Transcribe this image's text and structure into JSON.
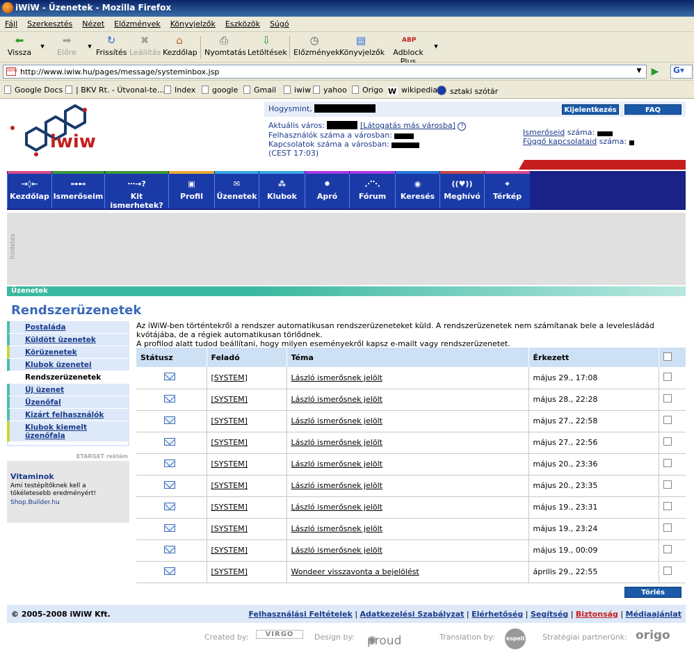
{
  "window": {
    "title": "iWiW - Üzenetek - Mozilla Firefox"
  },
  "menu": [
    "Fájl",
    "Szerkesztés",
    "Nézet",
    "Előzmények",
    "Könyvjelzők",
    "Eszközök",
    "Súgó"
  ],
  "toolbar": {
    "back": "Vissza",
    "forward": "Előre",
    "reload": "Frissítés",
    "stop": "Leállítás",
    "home": "Kezdőlap",
    "print": "Nyomtatás",
    "downloads": "Letöltések",
    "history": "Előzmények",
    "bookmarks": "Könyvjelzők",
    "adblock": "Adblock Plus"
  },
  "url": "http://www.iwiw.hu/pages/message/systeminbox.jsp",
  "bookmarks": [
    "Google Docs",
    "| BKV Rt. - Útvonal-te...",
    "Index",
    "google",
    "Gmail",
    "iwiw",
    "yahoo",
    "Origo",
    "wikipedia",
    "sztaki szótár"
  ],
  "header": {
    "greeting": "Hogysmint,",
    "logout": "Kijelentkezés",
    "faq": "FAQ",
    "city_label": "Aktuális város:",
    "visit_other": "[Látogatás más városba]",
    "users_label": "Felhasználók száma a városban:",
    "connections_label": "Kapcsolatok száma a városban:",
    "time": "(CEST 17:03)",
    "friends_link": "Ismerőseid",
    "friends_suffix": " száma:",
    "pending_link": "Függő kapcsolataid",
    "pending_suffix": " száma:"
  },
  "nav": [
    {
      "label": "Kezdőlap",
      "icon": "→◊←",
      "color": "#d84a8a"
    },
    {
      "label": "Ismerőseim",
      "icon": "⊶⊷",
      "color": "#3a9a3a"
    },
    {
      "label": "Kit ismerhetek?",
      "icon": "⋯→?",
      "color": "#3a9a3a"
    },
    {
      "label": "Profil",
      "icon": "▣",
      "color": "#e8a838"
    },
    {
      "label": "Üzenetek",
      "icon": "✉",
      "color": "#38a8e8"
    },
    {
      "label": "Klubok",
      "icon": "⁂",
      "color": "#38a8e8"
    },
    {
      "label": "Apró",
      "icon": "✸",
      "color": "#a838e8"
    },
    {
      "label": "Fórum",
      "icon": "⋰⋱",
      "color": "#a838e8"
    },
    {
      "label": "Keresés",
      "icon": "◉",
      "color": "#2878d8"
    },
    {
      "label": "Meghívó",
      "icon": "((♥))",
      "color": "#c84848"
    },
    {
      "label": "Térkép",
      "icon": "⌖",
      "color": "#d84a8a"
    }
  ],
  "ad_label": "hirdetés",
  "breadcrumb": "Üzenetek",
  "page_title": "Rendszerüzenetek",
  "sidebar": [
    {
      "label": "Postaláda"
    },
    {
      "label": "Küldött üzenetek"
    },
    {
      "label": "Körüzenetek"
    },
    {
      "label": "Klubok üzenetei"
    },
    {
      "label": "Rendszerüzenetek"
    },
    {
      "label": "Új üzenet"
    },
    {
      "label": "Üzenőfal"
    },
    {
      "label": "Kizárt felhasználók"
    },
    {
      "label": "Klubok kiemelt üzenőfala"
    }
  ],
  "promo": {
    "header": "ETARGET reklám",
    "title": "Vitaminok",
    "text": "Ami testépítőknek kell a tökéletesebb eredményért!",
    "link": "Shop.Builder.hu"
  },
  "intro": "Az iWiW-ben történtekről a rendszer automatikusan rendszerüzeneteket küld. A rendszerüzenetek nem számítanak bele a levelesládád kvótájába, de a régiek automatikusan törlődnek.\nA profilod alatt tudod beállítani, hogy milyen eseményekről kapsz e-mailt vagy rendszerüzenetet.",
  "table": {
    "headers": [
      "Státusz",
      "Feladó",
      "Téma",
      "Érkezett"
    ],
    "rows": [
      {
        "sender": "[SYSTEM]",
        "subject": "László ismerősnek jelölt",
        "received": "május 29., 17:08"
      },
      {
        "sender": "[SYSTEM]",
        "subject": "László ismerősnek jelölt",
        "received": "május 28., 22:28"
      },
      {
        "sender": "[SYSTEM]",
        "subject": "László ismerősnek jelölt",
        "received": "május 27., 22:58"
      },
      {
        "sender": "[SYSTEM]",
        "subject": "László ismerősnek jelölt",
        "received": "május 27., 22:56"
      },
      {
        "sender": "[SYSTEM]",
        "subject": "László ismerősnek jelölt",
        "received": "május 20., 23:36"
      },
      {
        "sender": "[SYSTEM]",
        "subject": "László ismerősnek jelölt",
        "received": "május 20., 23:35"
      },
      {
        "sender": "[SYSTEM]",
        "subject": "László ismerősnek jelölt",
        "received": "május 19., 23:31"
      },
      {
        "sender": "[SYSTEM]",
        "subject": "László ismerősnek jelölt",
        "received": "május 19., 23:24"
      },
      {
        "sender": "[SYSTEM]",
        "subject": "László ismerősnek jelölt",
        "received": "május 19., 00:09"
      },
      {
        "sender": "[SYSTEM]",
        "subject": "Wondeer visszavonta a bejelölést",
        "received": "április 29., 22:55"
      }
    ]
  },
  "delete_button": "Törlés",
  "footer": {
    "copyright": "© 2005-2008 iWiW Kft.",
    "links": [
      {
        "label": "Felhasználási Feltételek"
      },
      {
        "label": "Adatkezelési Szabályzat"
      },
      {
        "label": "Elérhetőség"
      },
      {
        "label": "Segítség"
      },
      {
        "label": "Biztonság",
        "red": true
      },
      {
        "label": "Médiaajánlat"
      }
    ]
  },
  "credits": {
    "created_by": "Created by:",
    "created_logo": "VIRGO",
    "design_by": "Design by:",
    "design_logo": "proud",
    "translation_by": "Translation by:",
    "translation_logo": "espell",
    "partner": "Stratégiai partnerünk:",
    "partner_logo": "origo"
  }
}
